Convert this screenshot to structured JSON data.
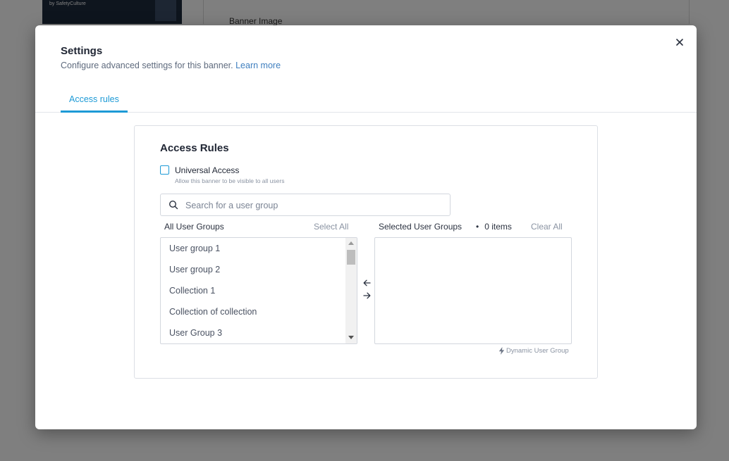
{
  "background": {
    "thumbnail_caption": "by SafetyCulture",
    "field_label": "Banner Image"
  },
  "modal": {
    "title": "Settings",
    "subtitle": "Configure advanced settings for this banner.",
    "learn_more": "Learn more",
    "close_icon": "close-icon",
    "tabs": [
      {
        "label": "Access rules",
        "active": true
      }
    ]
  },
  "access_rules": {
    "title": "Access Rules",
    "universal_access": {
      "label": "Universal Access",
      "help": "Allow this banner to be visible to all users",
      "checked": false
    },
    "search": {
      "placeholder": "Search for a user group",
      "value": "",
      "icon": "search-icon"
    },
    "all_groups": {
      "header": "All User Groups",
      "select_all": "Select All",
      "items": [
        "User group 1",
        "User group 2",
        "Collection 1",
        "Collection of collection",
        "User Group 3"
      ]
    },
    "selected_groups": {
      "header": "Selected User Groups",
      "count": "0 items",
      "clear_all": "Clear All",
      "items": []
    },
    "legend": {
      "icon": "lightning-bolt-icon",
      "label": "Dynamic User Group"
    }
  },
  "colors": {
    "accent": "#1d9ad6",
    "link": "#3f7fbf",
    "muted": "#8a93a2",
    "overlay": "rgba(0,0,0,0.5)"
  }
}
